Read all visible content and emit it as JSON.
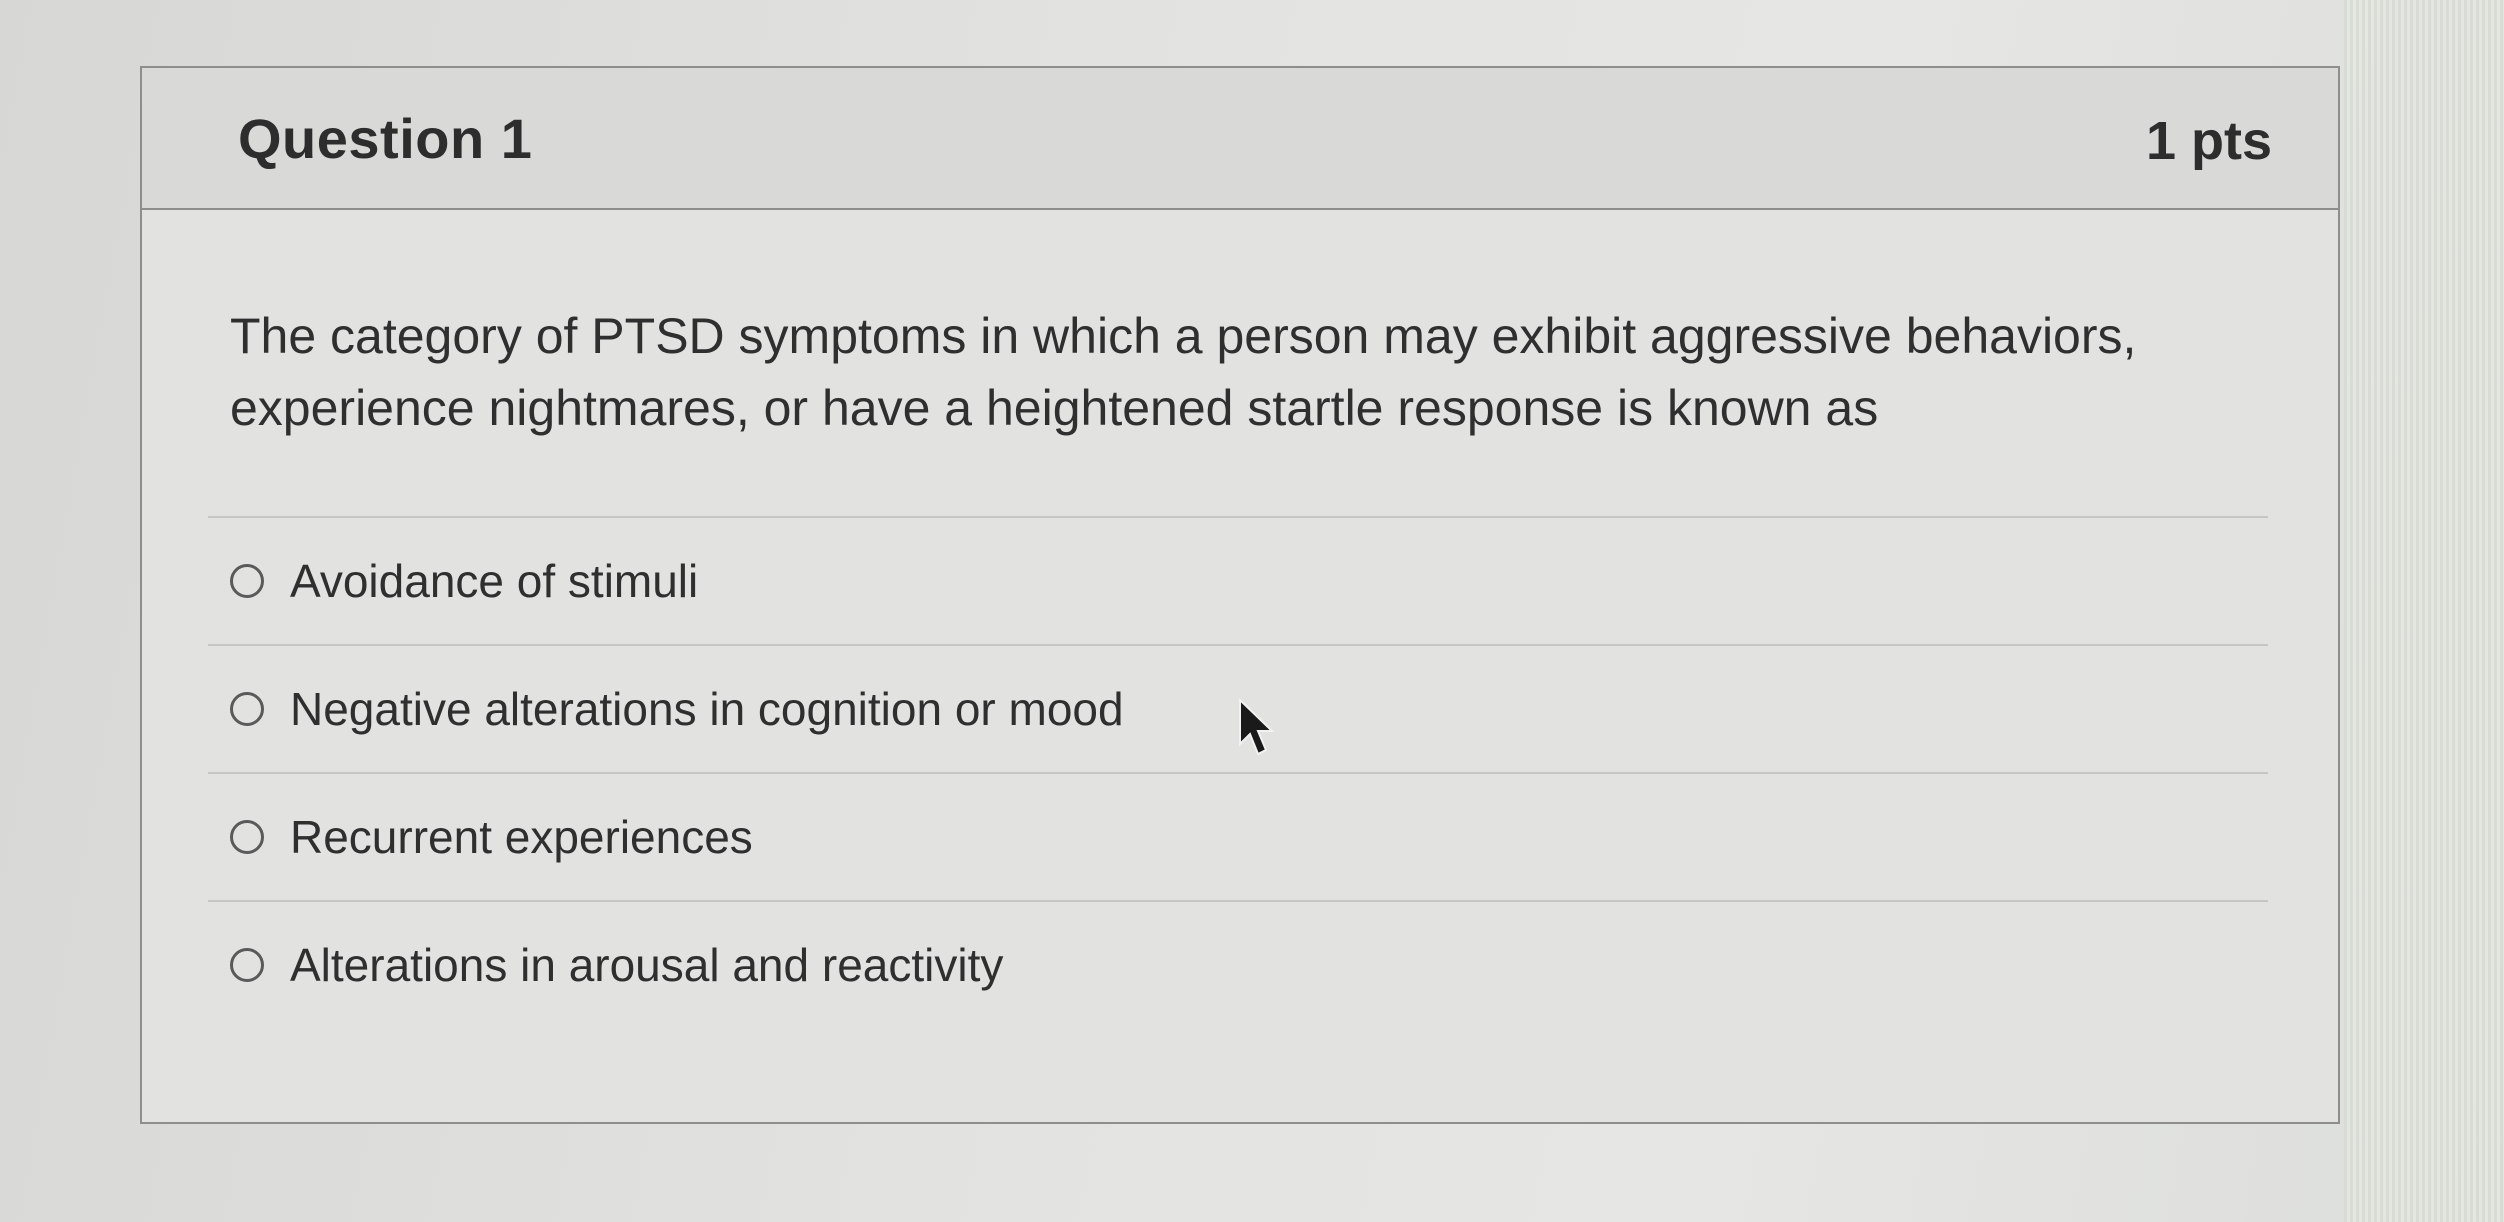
{
  "question": {
    "title": "Question 1",
    "points": "1 pts",
    "text": "The category of PTSD symptoms in which a person may exhibit aggressive behaviors, experience nightmares, or have a heightened startle response is known as"
  },
  "answers": [
    {
      "label": "Avoidance of stimuli",
      "selected": false
    },
    {
      "label": "Negative alterations in cognition or mood",
      "selected": false
    },
    {
      "label": "Recurrent experiences",
      "selected": false
    },
    {
      "label": "Alterations in arousal and reactivity",
      "selected": false
    }
  ],
  "icons": {
    "cursor": "mouse-pointer-icon",
    "radio": "radio-unchecked-icon"
  },
  "colors": {
    "text": "#2d2d2d",
    "border": "#8e8e8c",
    "header_bg": "#d9d9d7",
    "card_bg": "#e2e2e0"
  }
}
